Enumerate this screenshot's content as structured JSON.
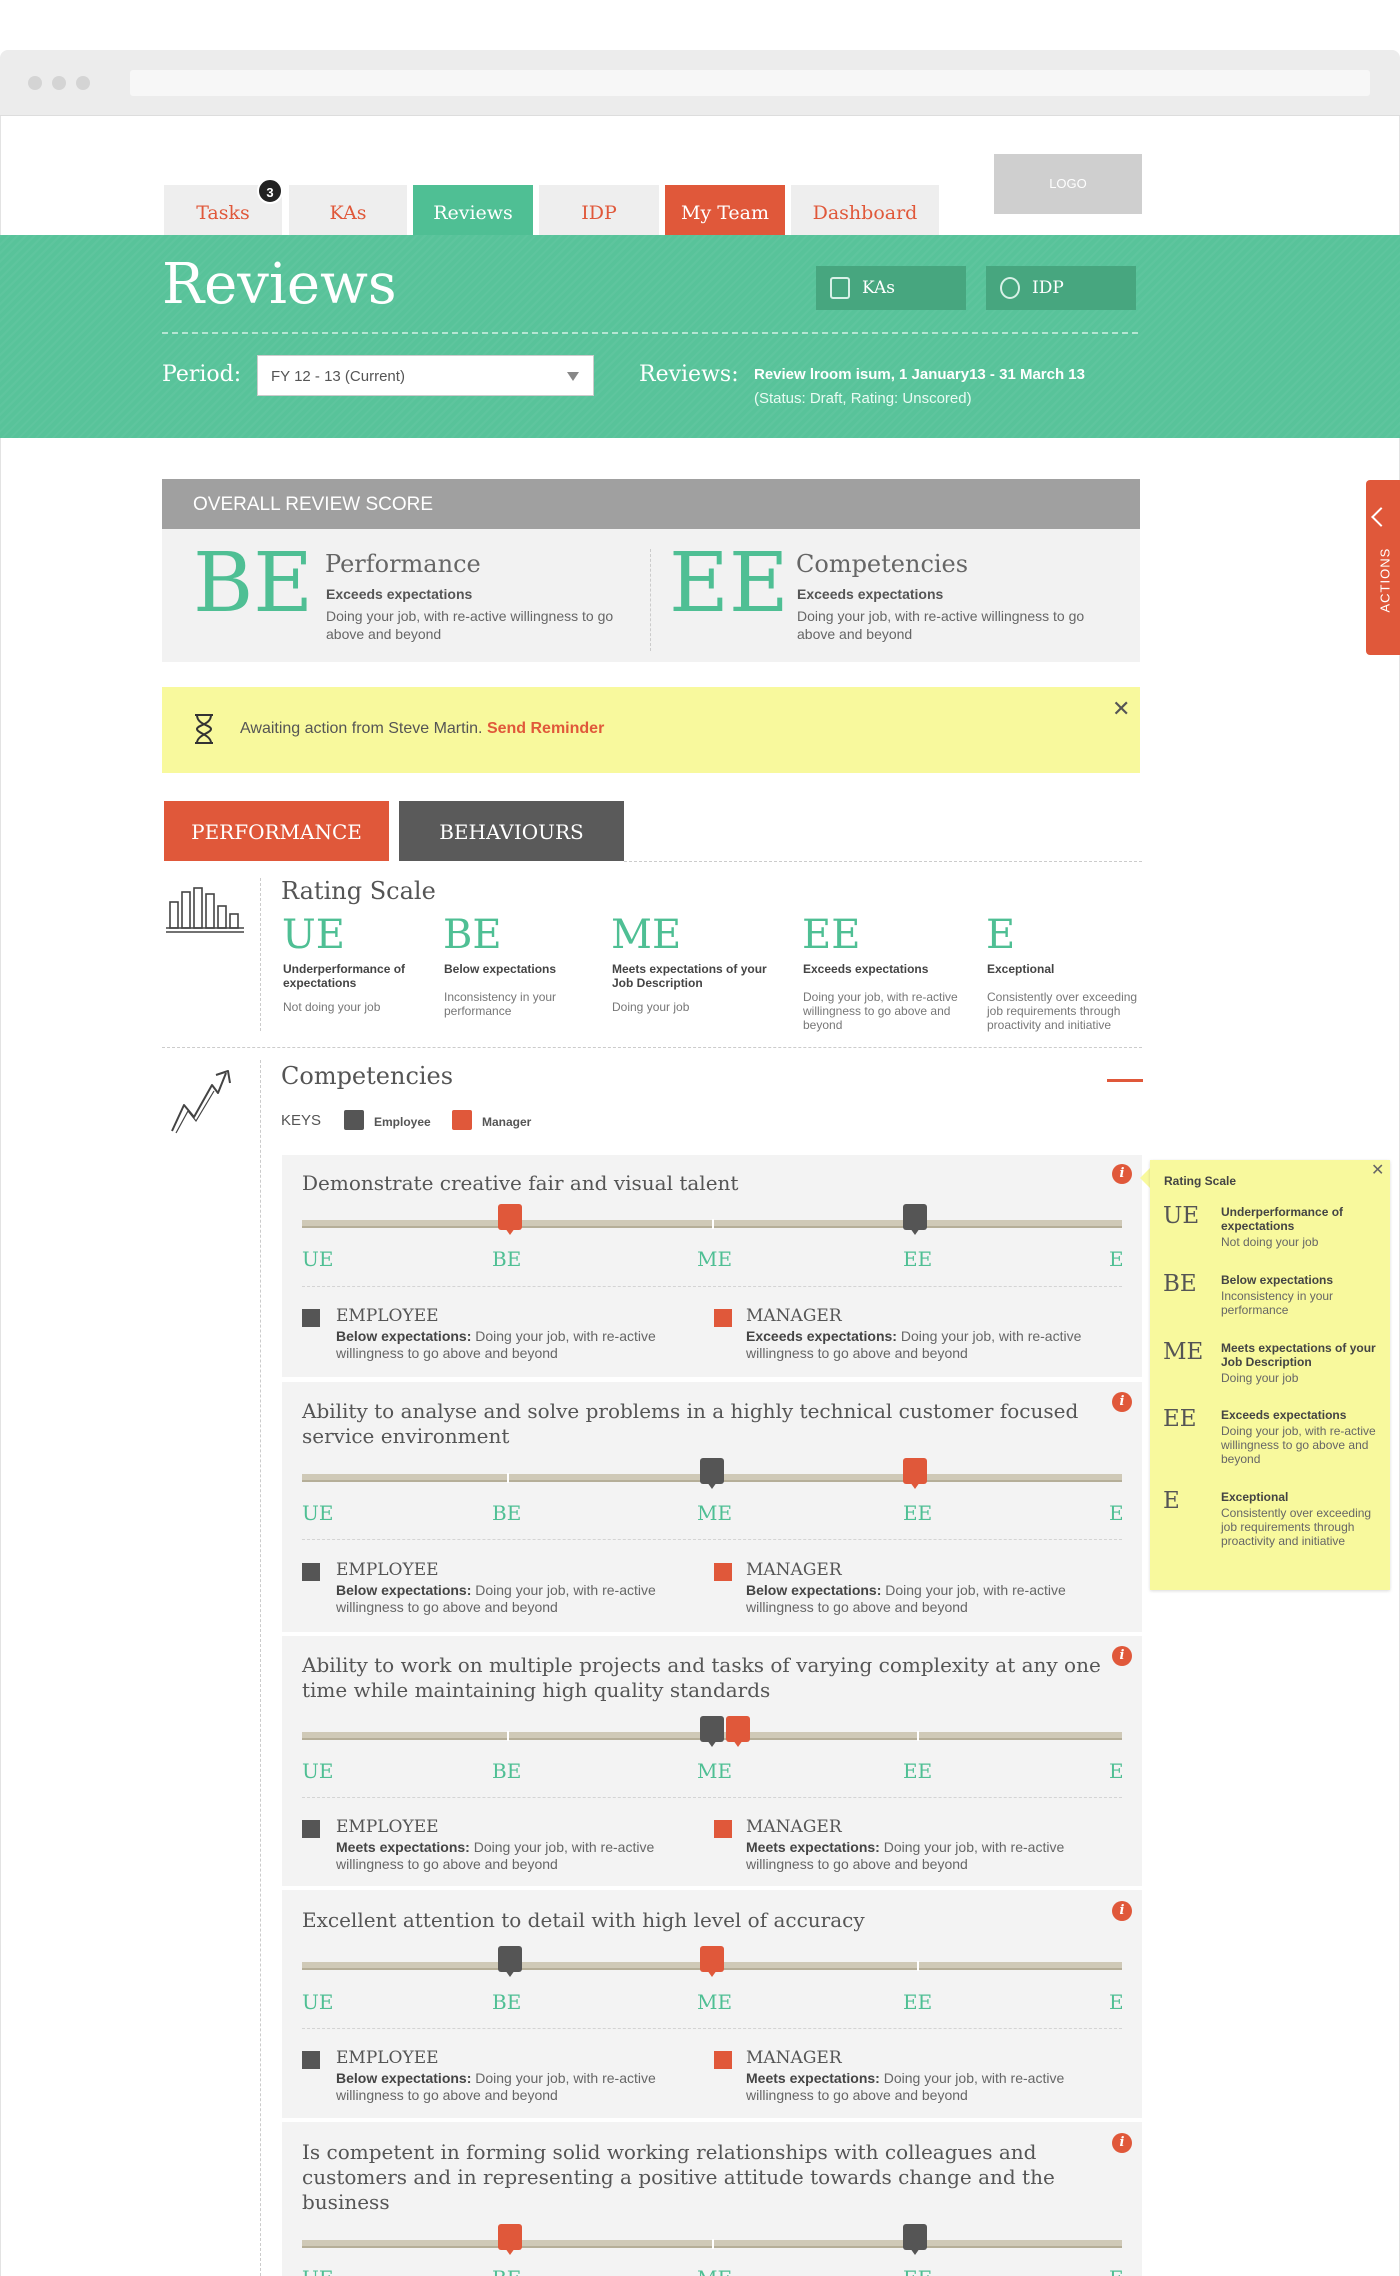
{
  "tabs": [
    {
      "label": "Tasks"
    },
    {
      "label": "KAs"
    },
    {
      "label": "Reviews"
    },
    {
      "label": "IDP"
    },
    {
      "label": "My Team"
    },
    {
      "label": "Dashboard"
    }
  ],
  "tasks_badge": "3",
  "logo": "LOGO",
  "header": {
    "title": "Reviews",
    "ka_button": "KAs",
    "idp_button": "IDP",
    "period_label": "Period:",
    "period_value": "FY 12 - 13 (Current)",
    "reviews_label": "Reviews:",
    "reviews_value": "Review lroom isum, 1 January13 - 31 March 13",
    "reviews_status": "(Status: Draft, Rating: Unscored)"
  },
  "overall": {
    "heading": "OVERALL REVIEW SCORE",
    "performance": {
      "code": "BE",
      "name": "Performance",
      "rating": "Exceeds expectations",
      "desc": "Doing your job, with re-active willingness to go above and beyond"
    },
    "competencies": {
      "code": "EE",
      "name": "Competencies",
      "rating": "Exceeds expectations",
      "desc": "Doing your job, with re-active willingness to go above and beyond"
    }
  },
  "notice": {
    "text": "Awaiting action from Steve Martin.",
    "link": "Send Reminder",
    "close": "✕"
  },
  "section_tabs": {
    "performance": "PERFORMANCE",
    "behaviours": "BEHAVIOURS"
  },
  "rating_scale": {
    "title": "Rating Scale",
    "items": [
      {
        "code": "UE",
        "name": "Underperformance of expectations",
        "desc": "Not doing your job"
      },
      {
        "code": "BE",
        "name": "Below expectations",
        "desc": "Inconsistency in your performance"
      },
      {
        "code": "ME",
        "name": "Meets expectations of your Job Description",
        "desc": "Doing your job"
      },
      {
        "code": "EE",
        "name": "Exceeds expectations",
        "desc": "Doing your job, with re-active willingness to go above and beyond"
      },
      {
        "code": "E",
        "name": "Exceptional",
        "desc": "Consistently over exceeding job requirements through proactivity and initiative"
      }
    ]
  },
  "competencies": {
    "title": "Competencies",
    "keys_label": "KEYS",
    "key_employee": "Employee",
    "key_manager": "Manager",
    "scale_labels": [
      "UE",
      "BE",
      "ME",
      "EE",
      "E"
    ],
    "employee_label": "EMPLOYEE",
    "manager_label": "MANAGER",
    "items": [
      {
        "title": "Demonstrate creative fair and visual talent",
        "employee_level": 3,
        "manager_level": 1,
        "employee_rating": "Below expectations:",
        "employee_desc": "Doing your job, with re-active willingness to go above and beyond",
        "manager_rating": "Exceeds expectations:",
        "manager_desc": "Doing your job, with re-active willingness to go above and beyond"
      },
      {
        "title": "Ability to analyse and solve problems in a highly technical customer focused service environment",
        "employee_level": 2,
        "manager_level": 3,
        "employee_rating": "Below expectations:",
        "employee_desc": "Doing your job, with re-active willingness to go above and beyond",
        "manager_rating": "Below expectations:",
        "manager_desc": "Doing your job, with re-active willingness to go above and beyond"
      },
      {
        "title": "Ability to work on multiple projects and tasks of varying complexity at any one time while maintaining high quality standards",
        "employee_level": 2,
        "manager_level": 2.13,
        "employee_rating": "Meets expectations:",
        "employee_desc": "Doing your job, with re-active willingness to go above and beyond",
        "manager_rating": "Meets expectations:",
        "manager_desc": "Doing your job, with re-active willingness to go above and beyond"
      },
      {
        "title": "Excellent attention to detail with high level of accuracy",
        "employee_level": 1,
        "manager_level": 2,
        "employee_rating": "Below expectations:",
        "employee_desc": "Doing your job, with re-active willingness to go above and beyond",
        "manager_rating": "Meets expectations:",
        "manager_desc": "Doing your job, with re-active willingness to go above and beyond"
      },
      {
        "title": "Is competent in forming solid working relationships with colleagues and customers and in representing a positive attitude towards change and the business",
        "employee_level": 3,
        "manager_level": 1
      }
    ]
  },
  "tooltip": {
    "title": "Rating Scale",
    "items": [
      {
        "code": "UE",
        "name": "Underperformance of expectations",
        "desc": "Not doing your job"
      },
      {
        "code": "BE",
        "name": "Below expectations",
        "desc": "Inconsistency in your performance"
      },
      {
        "code": "ME",
        "name": "Meets expectations of your Job Description",
        "desc": "Doing your job"
      },
      {
        "code": "EE",
        "name": "Exceeds expectations",
        "desc": "Doing your job, with re-active willingness to go above and beyond"
      },
      {
        "code": "E",
        "name": "Exceptional",
        "desc": "Consistently over exceeding job requirements through proactivity and initiative"
      }
    ]
  },
  "actions_tab": "ACTIONS",
  "colors": {
    "accent_green": "#4fbf94",
    "accent_red": "#e0583a",
    "employee_marker": "#555555"
  },
  "icons": {
    "notice": "hourglass-icon",
    "rating_scale": "bar-chart-sketch-icon",
    "competencies": "trend-arrow-sketch-icon",
    "info": "info-icon"
  }
}
